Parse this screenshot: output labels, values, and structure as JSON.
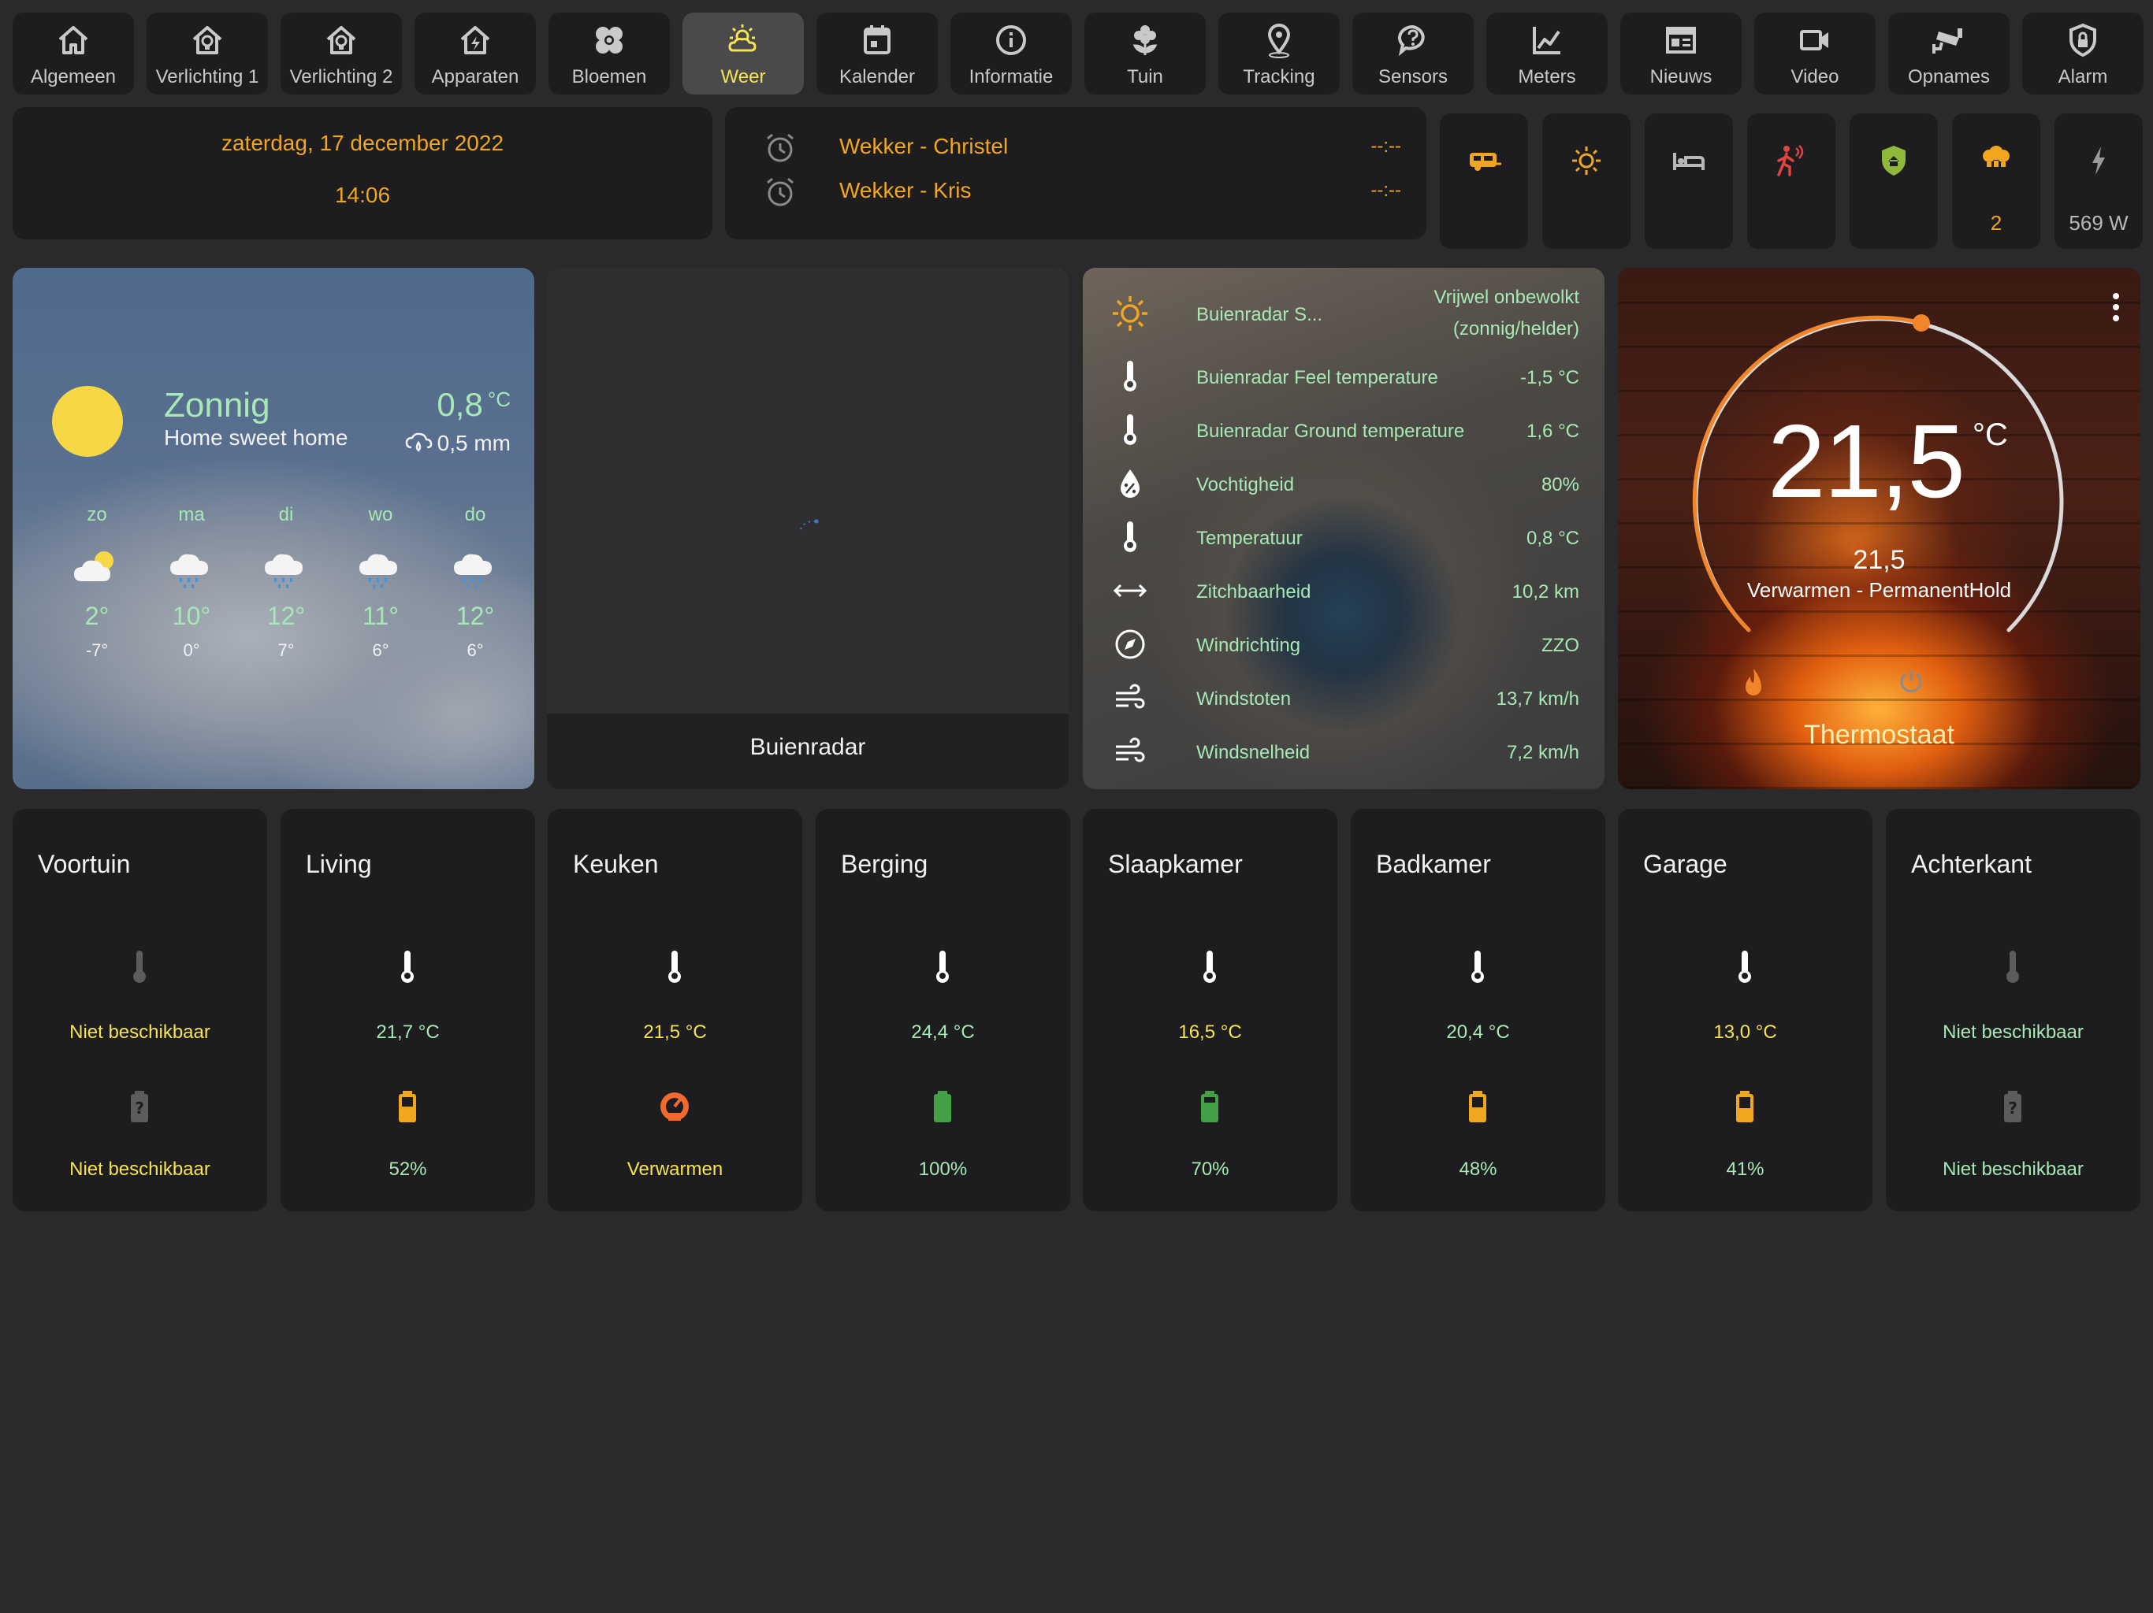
{
  "nav": {
    "tabs": [
      {
        "label": "Algemeen",
        "icon": "home-icon"
      },
      {
        "label": "Verlichting 1",
        "icon": "home-lightbulb-icon"
      },
      {
        "label": "Verlichting 2",
        "icon": "home-lightbulb-icon"
      },
      {
        "label": "Apparaten",
        "icon": "home-lightning-icon"
      },
      {
        "label": "Bloemen",
        "icon": "flower-icon"
      },
      {
        "label": "Weer",
        "icon": "weather-partly-cloudy-icon"
      },
      {
        "label": "Kalender",
        "icon": "calendar-icon"
      },
      {
        "label": "Informatie",
        "icon": "information-icon"
      },
      {
        "label": "Tuin",
        "icon": "flower-garden-icon"
      },
      {
        "label": "Tracking",
        "icon": "map-marker-icon"
      },
      {
        "label": "Sensors",
        "icon": "help-chat-icon"
      },
      {
        "label": "Meters",
        "icon": "chart-line-icon"
      },
      {
        "label": "Nieuws",
        "icon": "newspaper-icon"
      },
      {
        "label": "Video",
        "icon": "video-icon"
      },
      {
        "label": "Opnames",
        "icon": "cctv-icon"
      },
      {
        "label": "Alarm",
        "icon": "shield-lock-icon"
      }
    ],
    "active": "Weer"
  },
  "header": {
    "date": "zaterdag, 17 december 2022",
    "time": "14:06"
  },
  "alarms": [
    {
      "name": "Wekker - Christel",
      "time": "--:--"
    },
    {
      "name": "Wekker - Kris",
      "time": "--:--"
    }
  ],
  "quick_buttons": [
    {
      "icon": "caravan-icon",
      "value": "",
      "color": "#f0a61f"
    },
    {
      "icon": "brightness-icon",
      "value": "",
      "color": "#f0a61f"
    },
    {
      "icon": "bed-icon",
      "value": "",
      "color": "#b8b8b8"
    },
    {
      "icon": "motion-sensor-icon",
      "value": "",
      "color": "#e0443e"
    },
    {
      "icon": "shield-home-icon",
      "value": "",
      "color": "#8fb83a"
    },
    {
      "icon": "lightbulb-group-icon",
      "value": "2",
      "color": "#f0a61f"
    },
    {
      "icon": "flash-icon",
      "value": "569 W",
      "color": "#b8b8b8"
    }
  ],
  "weather": {
    "condition": "Zonnig",
    "location": "Home sweet home",
    "temperature": "0,8",
    "temp_unit": "°C",
    "precipitation": "0,5 mm",
    "forecast": [
      {
        "day": "zo",
        "icon": "partly-cloudy-icon",
        "high": "2°",
        "low": "-7°"
      },
      {
        "day": "ma",
        "icon": "rainy-icon",
        "high": "10°",
        "low": "0°"
      },
      {
        "day": "di",
        "icon": "rainy-icon",
        "high": "12°",
        "low": "7°"
      },
      {
        "day": "wo",
        "icon": "rainy-icon",
        "high": "11°",
        "low": "6°"
      },
      {
        "day": "do",
        "icon": "rainy-icon",
        "high": "12°",
        "low": "6°"
      }
    ]
  },
  "radar": {
    "title": "Buienradar"
  },
  "sensors": [
    {
      "icon": "sun-icon",
      "name": "Buienradar S...",
      "value_line1": "Vrijwel onbewolkt",
      "value_line2": "(zonnig/helder)"
    },
    {
      "icon": "thermometer-icon",
      "name": "Buienradar Feel temperature",
      "value": "-1,5 °C"
    },
    {
      "icon": "thermometer-icon",
      "name": "Buienradar Ground temperature",
      "value": "1,6 °C"
    },
    {
      "icon": "water-percent-icon",
      "name": "Vochtigheid",
      "value": "80%"
    },
    {
      "icon": "thermometer-icon",
      "name": "Temperatuur",
      "value": "0,8 °C"
    },
    {
      "icon": "arrow-left-right-icon",
      "name": "Zitchbaarheid",
      "value": "10,2 km"
    },
    {
      "icon": "compass-icon",
      "name": "Windrichting",
      "value": "ZZO"
    },
    {
      "icon": "weather-windy-icon",
      "name": "Windstoten",
      "value": "13,7 km/h"
    },
    {
      "icon": "weather-windy-icon",
      "name": "Windsnelheid",
      "value": "7,2 km/h"
    }
  ],
  "thermostat": {
    "current": "21,5",
    "unit": "°C",
    "target": "21,5",
    "mode": "Verwarmen - PermanentHold",
    "name": "Thermostaat"
  },
  "rooms": [
    {
      "name": "Voortuin",
      "temp": "Niet beschikbaar",
      "temp_available": false,
      "battery": "Niet beschikbaar",
      "battery_icon": "battery-unknown-icon",
      "battery_color": "#6a6a6a"
    },
    {
      "name": "Living",
      "temp": "21,7 °C",
      "temp_available": true,
      "battery": "52%",
      "battery_icon": "battery-icon",
      "battery_color": "#f0a61f"
    },
    {
      "name": "Keuken",
      "temp": "21,5 °C",
      "temp_available": true,
      "battery": "Verwarmen",
      "battery_icon": "heating-gauge-icon",
      "battery_color": "#f0692d"
    },
    {
      "name": "Berging",
      "temp": "24,4 °C",
      "temp_available": true,
      "battery": "100%",
      "battery_icon": "battery-icon",
      "battery_color": "#43a047"
    },
    {
      "name": "Slaapkamer",
      "temp": "16,5 °C",
      "temp_available": true,
      "battery": "70%",
      "battery_icon": "battery-icon",
      "battery_color": "#43a047"
    },
    {
      "name": "Badkamer",
      "temp": "20,4 °C",
      "temp_available": true,
      "battery": "48%",
      "battery_icon": "battery-icon",
      "battery_color": "#f0a61f"
    },
    {
      "name": "Garage",
      "temp": "13,0 °C",
      "temp_available": true,
      "battery": "41%",
      "battery_icon": "battery-icon",
      "battery_color": "#f0a61f"
    },
    {
      "name": "Achterkant",
      "temp": "Niet beschikbaar",
      "temp_available": false,
      "battery": "Niet beschikbaar",
      "battery_icon": "battery-unknown-icon",
      "battery_color": "#6a6a6a"
    }
  ]
}
